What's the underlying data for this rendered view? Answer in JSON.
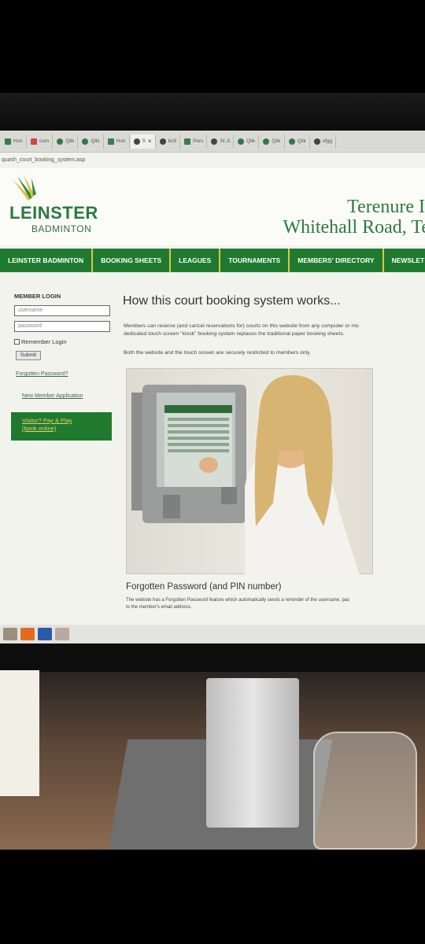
{
  "browser": {
    "tabs": [
      {
        "label": "Hon",
        "icon": "page-icon"
      },
      {
        "label": "com",
        "icon": "mail-icon"
      },
      {
        "label": "Qlik",
        "icon": "qlik-icon"
      },
      {
        "label": "Qlik",
        "icon": "qlik-icon"
      },
      {
        "label": "Hon",
        "icon": "home-icon"
      },
      {
        "label": "S",
        "icon": "site-icon",
        "active": true,
        "close": "×"
      },
      {
        "label": "bc9",
        "icon": "site-icon"
      },
      {
        "label": "Pers",
        "icon": "page-icon"
      },
      {
        "label": "St Ji",
        "icon": "site-icon"
      },
      {
        "label": "Qlik",
        "icon": "qlik-icon"
      },
      {
        "label": "Qlik",
        "icon": "qlik-icon"
      },
      {
        "label": "Qlik",
        "icon": "qlik-icon"
      },
      {
        "label": "sfgg",
        "icon": "site-icon"
      }
    ],
    "address": "quash_court_booking_system.asp"
  },
  "site": {
    "brand": "LEINSTER",
    "brand_sub": "BADMINTON",
    "venue_line1": "Terenure I",
    "venue_line2": "Whitehall Road, Te",
    "accent": "#1f7a2f"
  },
  "nav": [
    "LEINSTER BADMINTON",
    "BOOKING SHEETS",
    "LEAGUES",
    "TOURNAMENTS",
    "MEMBERS' DIRECTORY",
    "NEWSLET"
  ],
  "login": {
    "title": "MEMBER LOGIN",
    "username_placeholder": "username",
    "password_placeholder": "password",
    "remember": "Remember Login",
    "submit": "Submit",
    "forgotten": "Forgotten Password?",
    "new_member": "New Member Application",
    "visitor_line1": "Visitor? Pay & Play",
    "visitor_line2": "(book online)"
  },
  "main": {
    "title": "How this court booking system works...",
    "para1_line1": "Members can reserve (and cancel reservations for) courts on this website from any computer or mo",
    "para1_line2": "dedicated touch screen \"kiosk\" booking system replaces the traditional paper booking sheets.",
    "para2": "Both the website and the touch screen are securely restricted to members only.",
    "section2_title": "Forgotten Password (and PIN number)",
    "section2_line1": "The website has a Forgotten Password feature which automatically sends a reminder of the username, pas",
    "section2_line2": "to the member's email address."
  }
}
